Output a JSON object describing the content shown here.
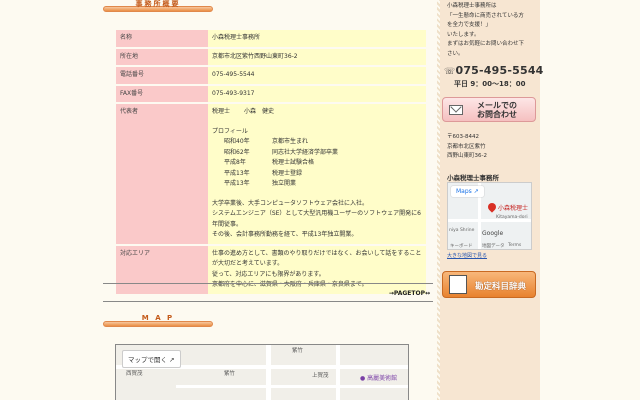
{
  "section_office": {
    "title": "事務所概要"
  },
  "info_rows": [
    {
      "key": "名称",
      "value": "小森税理士事務所"
    },
    {
      "key": "所在地",
      "value": "京都市北区紫竹西野山東町36-2"
    },
    {
      "key": "電話番号",
      "value": "075-495-5544"
    },
    {
      "key": "FAX番号",
      "value": "075-493-9317"
    }
  ],
  "representative": {
    "key": "代表者",
    "title": "税理士",
    "name": "小森　健史",
    "profile_label": "プロフィール",
    "history": [
      {
        "era": "昭和40年",
        "event": "京都市生まれ"
      },
      {
        "era": "昭和62年",
        "event": "同志社大学経済学部卒業"
      },
      {
        "era": "平成8年",
        "event": "税理士試験合格"
      },
      {
        "era": "平成13年",
        "event": "税理士登録"
      },
      {
        "era": "平成13年",
        "event": "独立開業"
      }
    ],
    "bio_lines": [
      "大学卒業後、大手コンピュータソフトウェア会社に入社。",
      "システムエンジニア（SE）として大型汎用機ユーザーのソフトウェア開発に6",
      "年間従事。",
      "その後、会計事務所勤務を経て、平成13年独立開業。"
    ]
  },
  "area": {
    "key": "対応エリア",
    "lines": [
      "仕事の進め方として、書類のやり取りだけではなく、お会いして話をすること",
      "が大切だと考えています。",
      "従って、対応エリアにも限界があります。",
      "京都府を中心に、滋賀県・大阪府・兵庫県・奈良県まで。"
    ]
  },
  "pagetop": "→PAGETOP↔",
  "section_map": {
    "title": "M A P"
  },
  "map": {
    "open_button": "マップで開く",
    "poi": "高麗美術館",
    "labels": [
      "紫竹",
      "西賀茂",
      "紫竹",
      "上賀茂"
    ]
  },
  "sidebar": {
    "intro_lines": [
      "小森税理士事務所は",
      "「一生懸命に商売されている方",
      "を全力で支援！」",
      "いたします。",
      "まずはお気軽にお問い合わせ下",
      "さい。"
    ],
    "tel": "075-495-5544",
    "hours": "平日 9：00～18：00",
    "contact_line1": "メールでの",
    "contact_line2": "お問合わせ",
    "address_lines": [
      "〒603-8442",
      "京都市北区紫竹",
      "西野山東町36-2"
    ],
    "office_name": "小森税理士事務所",
    "mini_map_button": "Maps",
    "mini_map_pin": "小森税理士",
    "mini_map_labels": [
      "Kitayama-dori",
      "niya Shrine",
      "Google",
      "地図データ",
      "Terms",
      "キーボード"
    ],
    "mini_map_link": "大きな地図で見る",
    "dict_button": "勘定科目辞典"
  },
  "colors": {
    "accent": "#ea8e45",
    "key_bg": "#fac9c9",
    "value_bg": "#fffdc9",
    "sidebar_bg": "#f7e6d2"
  }
}
